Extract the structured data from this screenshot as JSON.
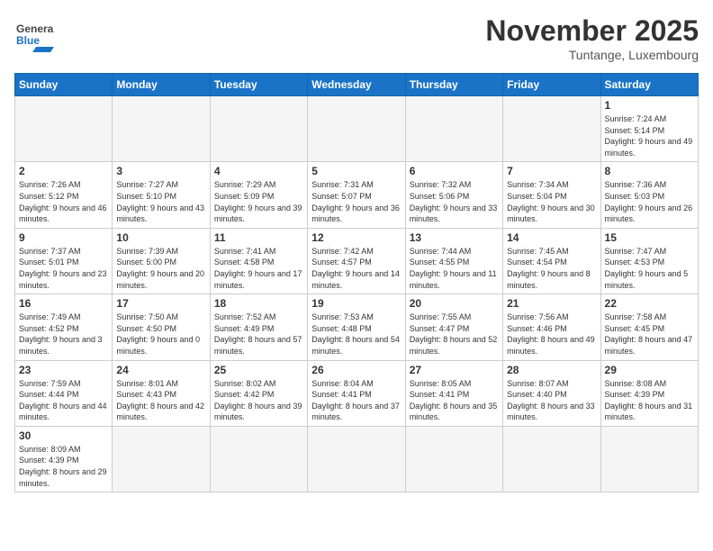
{
  "header": {
    "month_year": "November 2025",
    "location": "Tuntange, Luxembourg",
    "logo_general": "General",
    "logo_blue": "Blue"
  },
  "days_of_week": [
    "Sunday",
    "Monday",
    "Tuesday",
    "Wednesday",
    "Thursday",
    "Friday",
    "Saturday"
  ],
  "weeks": [
    [
      {
        "day": "",
        "info": ""
      },
      {
        "day": "",
        "info": ""
      },
      {
        "day": "",
        "info": ""
      },
      {
        "day": "",
        "info": ""
      },
      {
        "day": "",
        "info": ""
      },
      {
        "day": "",
        "info": ""
      },
      {
        "day": "1",
        "info": "Sunrise: 7:24 AM\nSunset: 5:14 PM\nDaylight: 9 hours\nand 49 minutes."
      }
    ],
    [
      {
        "day": "2",
        "info": "Sunrise: 7:26 AM\nSunset: 5:12 PM\nDaylight: 9 hours\nand 46 minutes."
      },
      {
        "day": "3",
        "info": "Sunrise: 7:27 AM\nSunset: 5:10 PM\nDaylight: 9 hours\nand 43 minutes."
      },
      {
        "day": "4",
        "info": "Sunrise: 7:29 AM\nSunset: 5:09 PM\nDaylight: 9 hours\nand 39 minutes."
      },
      {
        "day": "5",
        "info": "Sunrise: 7:31 AM\nSunset: 5:07 PM\nDaylight: 9 hours\nand 36 minutes."
      },
      {
        "day": "6",
        "info": "Sunrise: 7:32 AM\nSunset: 5:06 PM\nDaylight: 9 hours\nand 33 minutes."
      },
      {
        "day": "7",
        "info": "Sunrise: 7:34 AM\nSunset: 5:04 PM\nDaylight: 9 hours\nand 30 minutes."
      },
      {
        "day": "8",
        "info": "Sunrise: 7:36 AM\nSunset: 5:03 PM\nDaylight: 9 hours\nand 26 minutes."
      }
    ],
    [
      {
        "day": "9",
        "info": "Sunrise: 7:37 AM\nSunset: 5:01 PM\nDaylight: 9 hours\nand 23 minutes."
      },
      {
        "day": "10",
        "info": "Sunrise: 7:39 AM\nSunset: 5:00 PM\nDaylight: 9 hours\nand 20 minutes."
      },
      {
        "day": "11",
        "info": "Sunrise: 7:41 AM\nSunset: 4:58 PM\nDaylight: 9 hours\nand 17 minutes."
      },
      {
        "day": "12",
        "info": "Sunrise: 7:42 AM\nSunset: 4:57 PM\nDaylight: 9 hours\nand 14 minutes."
      },
      {
        "day": "13",
        "info": "Sunrise: 7:44 AM\nSunset: 4:55 PM\nDaylight: 9 hours\nand 11 minutes."
      },
      {
        "day": "14",
        "info": "Sunrise: 7:45 AM\nSunset: 4:54 PM\nDaylight: 9 hours\nand 8 minutes."
      },
      {
        "day": "15",
        "info": "Sunrise: 7:47 AM\nSunset: 4:53 PM\nDaylight: 9 hours\nand 5 minutes."
      }
    ],
    [
      {
        "day": "16",
        "info": "Sunrise: 7:49 AM\nSunset: 4:52 PM\nDaylight: 9 hours\nand 3 minutes."
      },
      {
        "day": "17",
        "info": "Sunrise: 7:50 AM\nSunset: 4:50 PM\nDaylight: 9 hours\nand 0 minutes."
      },
      {
        "day": "18",
        "info": "Sunrise: 7:52 AM\nSunset: 4:49 PM\nDaylight: 8 hours\nand 57 minutes."
      },
      {
        "day": "19",
        "info": "Sunrise: 7:53 AM\nSunset: 4:48 PM\nDaylight: 8 hours\nand 54 minutes."
      },
      {
        "day": "20",
        "info": "Sunrise: 7:55 AM\nSunset: 4:47 PM\nDaylight: 8 hours\nand 52 minutes."
      },
      {
        "day": "21",
        "info": "Sunrise: 7:56 AM\nSunset: 4:46 PM\nDaylight: 8 hours\nand 49 minutes."
      },
      {
        "day": "22",
        "info": "Sunrise: 7:58 AM\nSunset: 4:45 PM\nDaylight: 8 hours\nand 47 minutes."
      }
    ],
    [
      {
        "day": "23",
        "info": "Sunrise: 7:59 AM\nSunset: 4:44 PM\nDaylight: 8 hours\nand 44 minutes."
      },
      {
        "day": "24",
        "info": "Sunrise: 8:01 AM\nSunset: 4:43 PM\nDaylight: 8 hours\nand 42 minutes."
      },
      {
        "day": "25",
        "info": "Sunrise: 8:02 AM\nSunset: 4:42 PM\nDaylight: 8 hours\nand 39 minutes."
      },
      {
        "day": "26",
        "info": "Sunrise: 8:04 AM\nSunset: 4:41 PM\nDaylight: 8 hours\nand 37 minutes."
      },
      {
        "day": "27",
        "info": "Sunrise: 8:05 AM\nSunset: 4:41 PM\nDaylight: 8 hours\nand 35 minutes."
      },
      {
        "day": "28",
        "info": "Sunrise: 8:07 AM\nSunset: 4:40 PM\nDaylight: 8 hours\nand 33 minutes."
      },
      {
        "day": "29",
        "info": "Sunrise: 8:08 AM\nSunset: 4:39 PM\nDaylight: 8 hours\nand 31 minutes."
      }
    ],
    [
      {
        "day": "30",
        "info": "Sunrise: 8:09 AM\nSunset: 4:39 PM\nDaylight: 8 hours\nand 29 minutes."
      },
      {
        "day": "",
        "info": ""
      },
      {
        "day": "",
        "info": ""
      },
      {
        "day": "",
        "info": ""
      },
      {
        "day": "",
        "info": ""
      },
      {
        "day": "",
        "info": ""
      },
      {
        "day": "",
        "info": ""
      }
    ]
  ]
}
